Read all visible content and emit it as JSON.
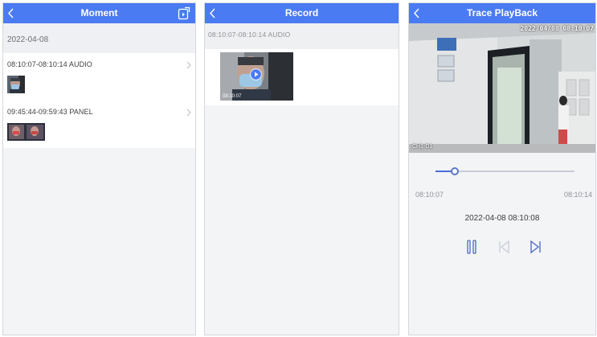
{
  "moment": {
    "title": "Moment",
    "date_header": "2022-04-08",
    "items": [
      {
        "label": "08:10:07-08:10:14 AUDIO"
      },
      {
        "label": "09:45:44-09:59:43 PANEL"
      }
    ]
  },
  "record": {
    "title": "Record",
    "range_label": "08:10:07-08:10:14 AUDIO",
    "thumb_time": "08:10:07"
  },
  "playback": {
    "title": "Trace PlayBack",
    "osd_timestamp": "2022/04/08 08:10:07",
    "channel_label": "CH1-D1",
    "start_time": "08:10:07",
    "end_time": "08:10:14",
    "current_time": "2022-04-08 08:10:08",
    "progress": 0.14
  },
  "colors": {
    "accent": "#4a7bf2",
    "background": "#f3f4f6"
  },
  "icons": [
    "back-icon",
    "export-icon",
    "chevron-right-icon",
    "play-icon",
    "pause-icon",
    "previous-icon",
    "next-icon"
  ]
}
